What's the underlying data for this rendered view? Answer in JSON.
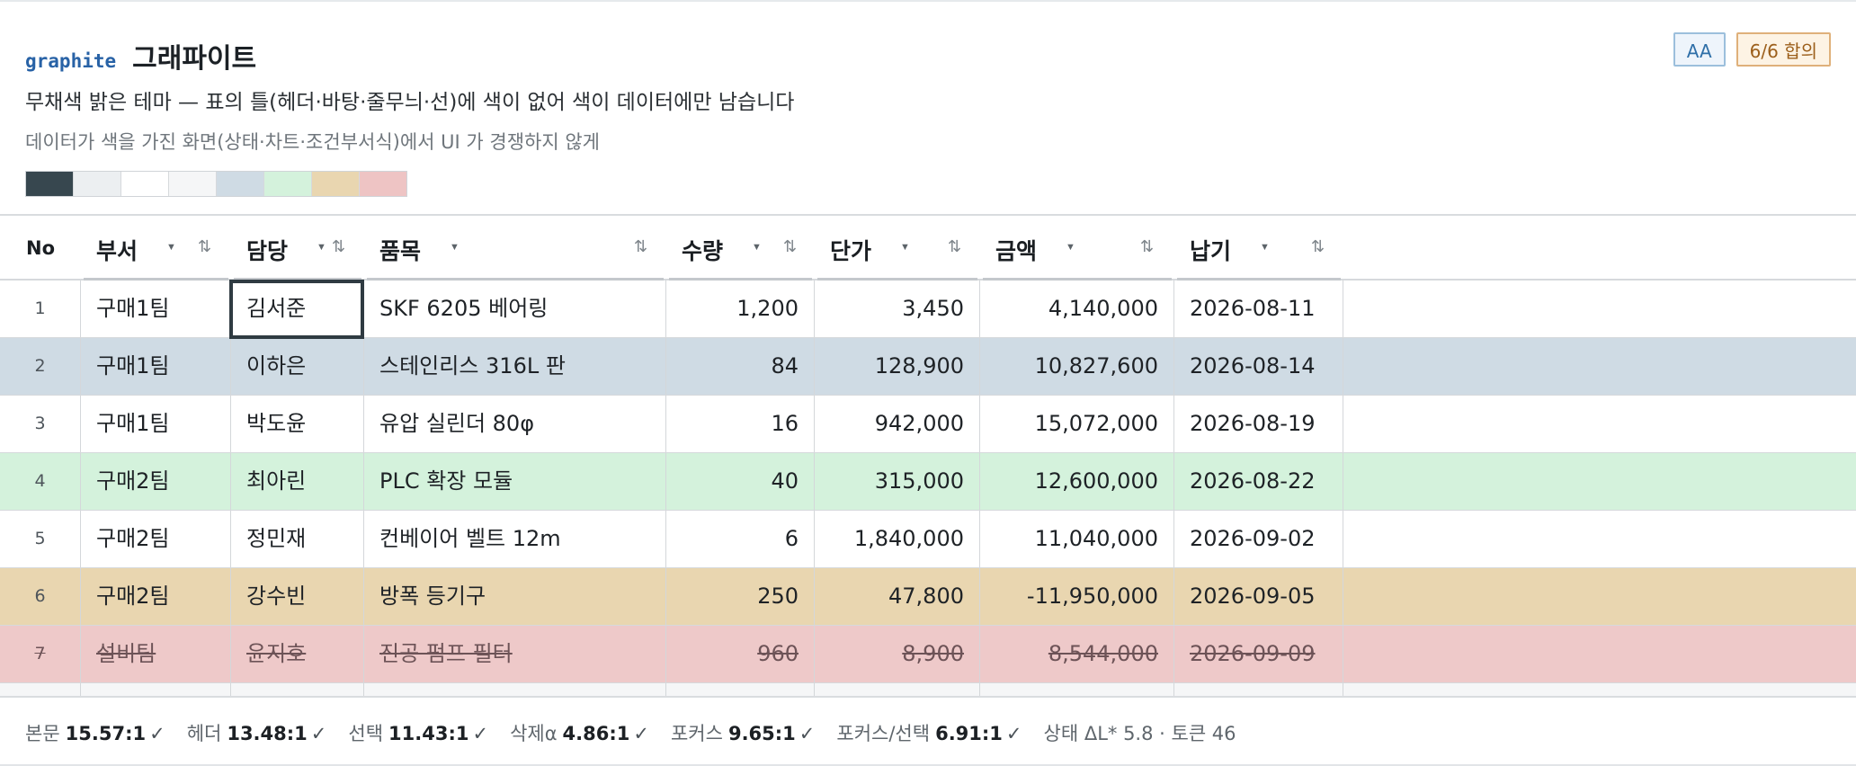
{
  "header": {
    "brand_code": "graphite",
    "brand_title": "그래파이트",
    "description": "무채색 밝은 테마 — 표의 틀(헤더·바탕·줄무늬·선)에 색이 없어 색이 데이터에만 남습니다",
    "subdescription": "데이터가 색을 가진 화면(상태·차트·조건부서식)에서 UI 가 경쟁하지 않게",
    "swatches": [
      "#37474f",
      "#eceff1",
      "#ffffff",
      "#f5f6f7",
      "#cfdbe4",
      "#d4f2dc",
      "#e9d6b0",
      "#eec4c4"
    ],
    "badges": {
      "aa": "AA",
      "agreement": "6/6 합의"
    }
  },
  "table": {
    "columns": [
      {
        "key": "no",
        "label": "No"
      },
      {
        "key": "dept",
        "label": "부서"
      },
      {
        "key": "owner",
        "label": "담당"
      },
      {
        "key": "item",
        "label": "품목"
      },
      {
        "key": "qty",
        "label": "수량"
      },
      {
        "key": "price",
        "label": "단가"
      },
      {
        "key": "amount",
        "label": "금액"
      },
      {
        "key": "due",
        "label": "납기"
      }
    ],
    "sort_glyph": "⇅",
    "filter_glyph": "▼",
    "rows": [
      {
        "no": "1",
        "dept": "구매1팀",
        "owner": "김서준",
        "item": "SKF 6205 베어링",
        "qty": "1,200",
        "price": "3,450",
        "amount": "4,140,000",
        "due": "2026-08-11",
        "state": "normal",
        "bg": "#ffffff"
      },
      {
        "no": "2",
        "dept": "구매1팀",
        "owner": "이하은",
        "item": "스테인리스 316L 판",
        "qty": "84",
        "price": "128,900",
        "amount": "10,827,600",
        "due": "2026-08-14",
        "state": "selected",
        "bg": "#cfdbe4"
      },
      {
        "no": "3",
        "dept": "구매1팀",
        "owner": "박도윤",
        "item": "유압 실린더 80φ",
        "qty": "16",
        "price": "942,000",
        "amount": "15,072,000",
        "due": "2026-08-19",
        "state": "normal",
        "bg": "#ffffff"
      },
      {
        "no": "4",
        "dept": "구매2팀",
        "owner": "최아린",
        "item": "PLC 확장 모듈",
        "qty": "40",
        "price": "315,000",
        "amount": "12,600,000",
        "due": "2026-08-22",
        "state": "success",
        "bg": "#d4f2dc"
      },
      {
        "no": "5",
        "dept": "구매2팀",
        "owner": "정민재",
        "item": "컨베이어 벨트 12m",
        "qty": "6",
        "price": "1,840,000",
        "amount": "11,040,000",
        "due": "2026-09-02",
        "state": "normal",
        "bg": "#ffffff"
      },
      {
        "no": "6",
        "dept": "구매2팀",
        "owner": "강수빈",
        "item": "방폭 등기구",
        "qty": "250",
        "price": "47,800",
        "amount": "-11,950,000",
        "due": "2026-09-05",
        "state": "warning",
        "bg": "#e9d6b0"
      },
      {
        "no": "7",
        "dept": "설비팀",
        "owner": "윤지호",
        "item": "진공 펌프 필터",
        "qty": "960",
        "price": "8,900",
        "amount": "8,544,000",
        "due": "2026-09-09",
        "state": "deleted",
        "bg": "#eec9c9"
      }
    ]
  },
  "footer": {
    "stats": [
      {
        "label": "본문",
        "value": "15.57:1",
        "mark": "✓"
      },
      {
        "label": "헤더",
        "value": "13.48:1",
        "mark": "✓"
      },
      {
        "label": "선택",
        "value": "11.43:1",
        "mark": "✓"
      },
      {
        "label": "삭제α",
        "value": "4.86:1",
        "mark": "✓"
      },
      {
        "label": "포커스",
        "value": "9.65:1",
        "mark": "✓"
      },
      {
        "label": "포커스/선택",
        "value": "6.91:1",
        "mark": "✓"
      }
    ],
    "state_info": "상태 ΔL* 5.8 · 토큰 46"
  }
}
